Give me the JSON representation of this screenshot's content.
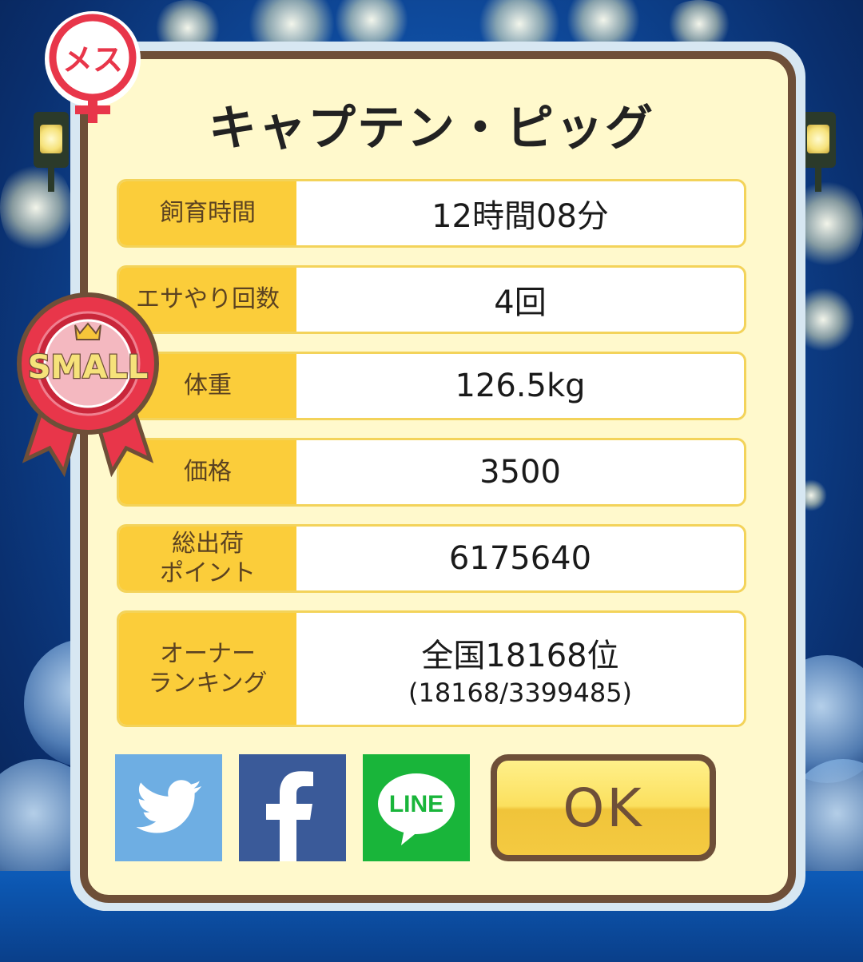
{
  "pig_name": "キャプテン・ピッグ",
  "gender_badge": "メス",
  "size_badge": "SMALL",
  "stats": [
    {
      "label": "飼育時間",
      "value": "12時間08分",
      "sub": ""
    },
    {
      "label": "エサやり回数",
      "value": "4回",
      "sub": ""
    },
    {
      "label": "体重",
      "value": "126.5kg",
      "sub": ""
    },
    {
      "label": "価格",
      "value": "3500",
      "sub": ""
    },
    {
      "label": "総出荷\nポイント",
      "value": "6175640",
      "sub": ""
    },
    {
      "label": "オーナー\nランキング",
      "value": "全国18168位",
      "sub": "(18168/3399485)"
    }
  ],
  "share": {
    "line_label": "LINE",
    "facebook_glyph": "f"
  },
  "ok_label": "OK",
  "colors": {
    "label_bg": "#fbcd3a",
    "card_bg": "#fff9cc",
    "border": "#6e4f38",
    "twitter": "#6eaee3",
    "facebook": "#3a5a99",
    "line": "#19b53a"
  }
}
